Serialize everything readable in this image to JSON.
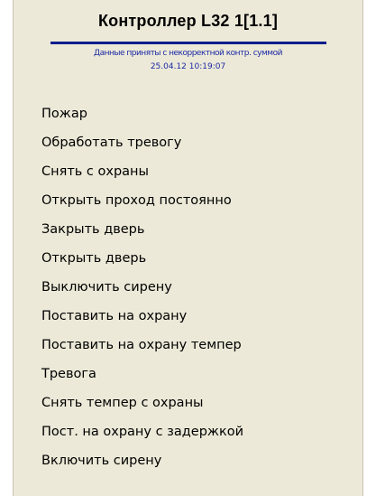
{
  "menu": {
    "title": "Контроллер L32 1[1.1]",
    "status_line_1": "Данные приняты с некорректной контр. суммой",
    "status_line_2": "25.04.12 10:19:07",
    "accent_color": "#0a1e8c",
    "items": [
      {
        "label": "Пожар"
      },
      {
        "label": "Обработать тревогу"
      },
      {
        "label": "Снять с охраны"
      },
      {
        "label": "Открыть проход постоянно"
      },
      {
        "label": "Закрыть дверь"
      },
      {
        "label": "Открыть дверь"
      },
      {
        "label": "Выключить сирену"
      },
      {
        "label": "Поставить на охрану"
      },
      {
        "label": "Поставить на охрану темпер"
      },
      {
        "label": "Тревога"
      },
      {
        "label": "Снять темпер с охраны"
      },
      {
        "label": "Пост. на охрану с задержкой"
      },
      {
        "label": "Включить сирену"
      }
    ]
  }
}
